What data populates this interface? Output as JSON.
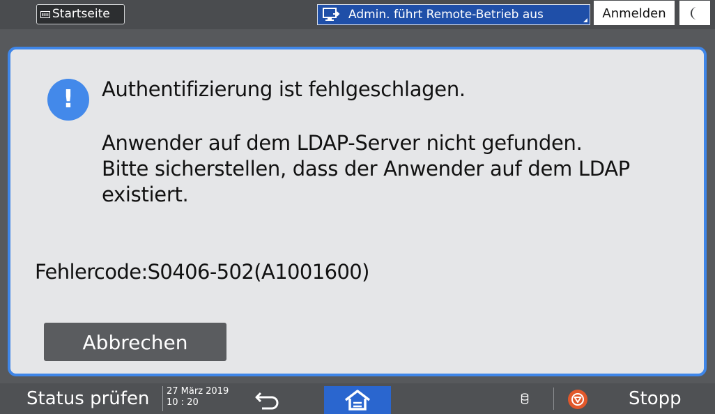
{
  "topbar": {
    "home_label": "Startseite",
    "remote_status": "Admin. führt Remote-Betrieb aus",
    "login_label": "Anmelden"
  },
  "dialog": {
    "title": "Authentifizierung ist fehlgeschlagen.",
    "body": "Anwender auf dem LDAP-Server nicht gefunden. Bitte sicherstellen, dass der Anwender auf dem LDAP existiert.",
    "error_code": "Fehlercode:S0406-502(A1001600)",
    "cancel_label": "Abbrechen"
  },
  "bottombar": {
    "status_label": "Status prüfen",
    "date": "27 März 2019",
    "time": "10 : 20",
    "stop_label": "Stopp"
  },
  "colors": {
    "accent": "#3f86e8",
    "home_active": "#2a66cf",
    "remote_bar": "#1f4fa8",
    "stop": "#e2582b"
  },
  "icons": {
    "home": "grid-icon",
    "remote": "remote-desktop-icon",
    "night": "moon-icon",
    "alert": "exclamation-icon",
    "back": "back-arrow-icon",
    "home_nav": "home-icon",
    "data": "data-storage-icon",
    "stop": "stop-icon"
  }
}
